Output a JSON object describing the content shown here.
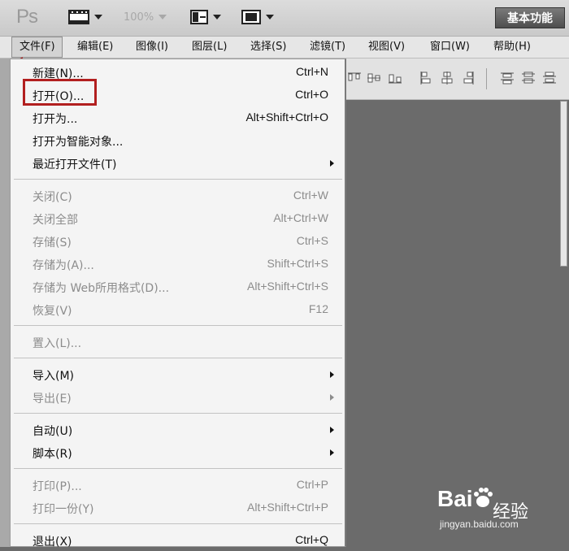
{
  "app": {
    "logo": "Ps",
    "zoom": "100%",
    "workspace": "基本功能"
  },
  "menubar": [
    {
      "label": "文件(F)",
      "active": true
    },
    {
      "label": "编辑(E)"
    },
    {
      "label": "图像(I)"
    },
    {
      "label": "图层(L)"
    },
    {
      "label": "选择(S)"
    },
    {
      "label": "滤镜(T)"
    },
    {
      "label": "视图(V)"
    },
    {
      "label": "窗口(W)"
    },
    {
      "label": "帮助(H)"
    }
  ],
  "file_menu": [
    {
      "label": "新建(N)...",
      "shortcut": "Ctrl+N",
      "enabled": true
    },
    {
      "label": "打开(O)...",
      "shortcut": "Ctrl+O",
      "enabled": true,
      "highlighted": true
    },
    {
      "label": "打开为...",
      "shortcut": "Alt+Shift+Ctrl+O",
      "enabled": true
    },
    {
      "label": "打开为智能对象...",
      "shortcut": "",
      "enabled": true
    },
    {
      "label": "最近打开文件(T)",
      "shortcut": "",
      "enabled": true,
      "submenu": true
    },
    {
      "separator": true
    },
    {
      "label": "关闭(C)",
      "shortcut": "Ctrl+W",
      "enabled": false
    },
    {
      "label": "关闭全部",
      "shortcut": "Alt+Ctrl+W",
      "enabled": false
    },
    {
      "label": "存储(S)",
      "shortcut": "Ctrl+S",
      "enabled": false
    },
    {
      "label": "存储为(A)...",
      "shortcut": "Shift+Ctrl+S",
      "enabled": false
    },
    {
      "label": "存储为 Web所用格式(D)...",
      "shortcut": "Alt+Shift+Ctrl+S",
      "enabled": false
    },
    {
      "label": "恢复(V)",
      "shortcut": "F12",
      "enabled": false
    },
    {
      "separator": true
    },
    {
      "label": "置入(L)...",
      "shortcut": "",
      "enabled": false
    },
    {
      "separator": true
    },
    {
      "label": "导入(M)",
      "shortcut": "",
      "enabled": true,
      "submenu": true
    },
    {
      "label": "导出(E)",
      "shortcut": "",
      "enabled": false,
      "submenu": true
    },
    {
      "separator": true
    },
    {
      "label": "自动(U)",
      "shortcut": "",
      "enabled": true,
      "submenu": true
    },
    {
      "label": "脚本(R)",
      "shortcut": "",
      "enabled": true,
      "submenu": true
    },
    {
      "separator": true
    },
    {
      "label": "打印(P)...",
      "shortcut": "Ctrl+P",
      "enabled": false
    },
    {
      "label": "打印一份(Y)",
      "shortcut": "Alt+Shift+Ctrl+P",
      "enabled": false
    },
    {
      "separator": true
    },
    {
      "label": "退出(X)",
      "shortcut": "Ctrl+Q",
      "enabled": true
    }
  ],
  "watermark": {
    "brand": "Bai",
    "sub": "经验",
    "url": "jingyan.baidu.com"
  },
  "colors": {
    "highlight": "#b21f1f",
    "arrow": "#b21f1f"
  }
}
